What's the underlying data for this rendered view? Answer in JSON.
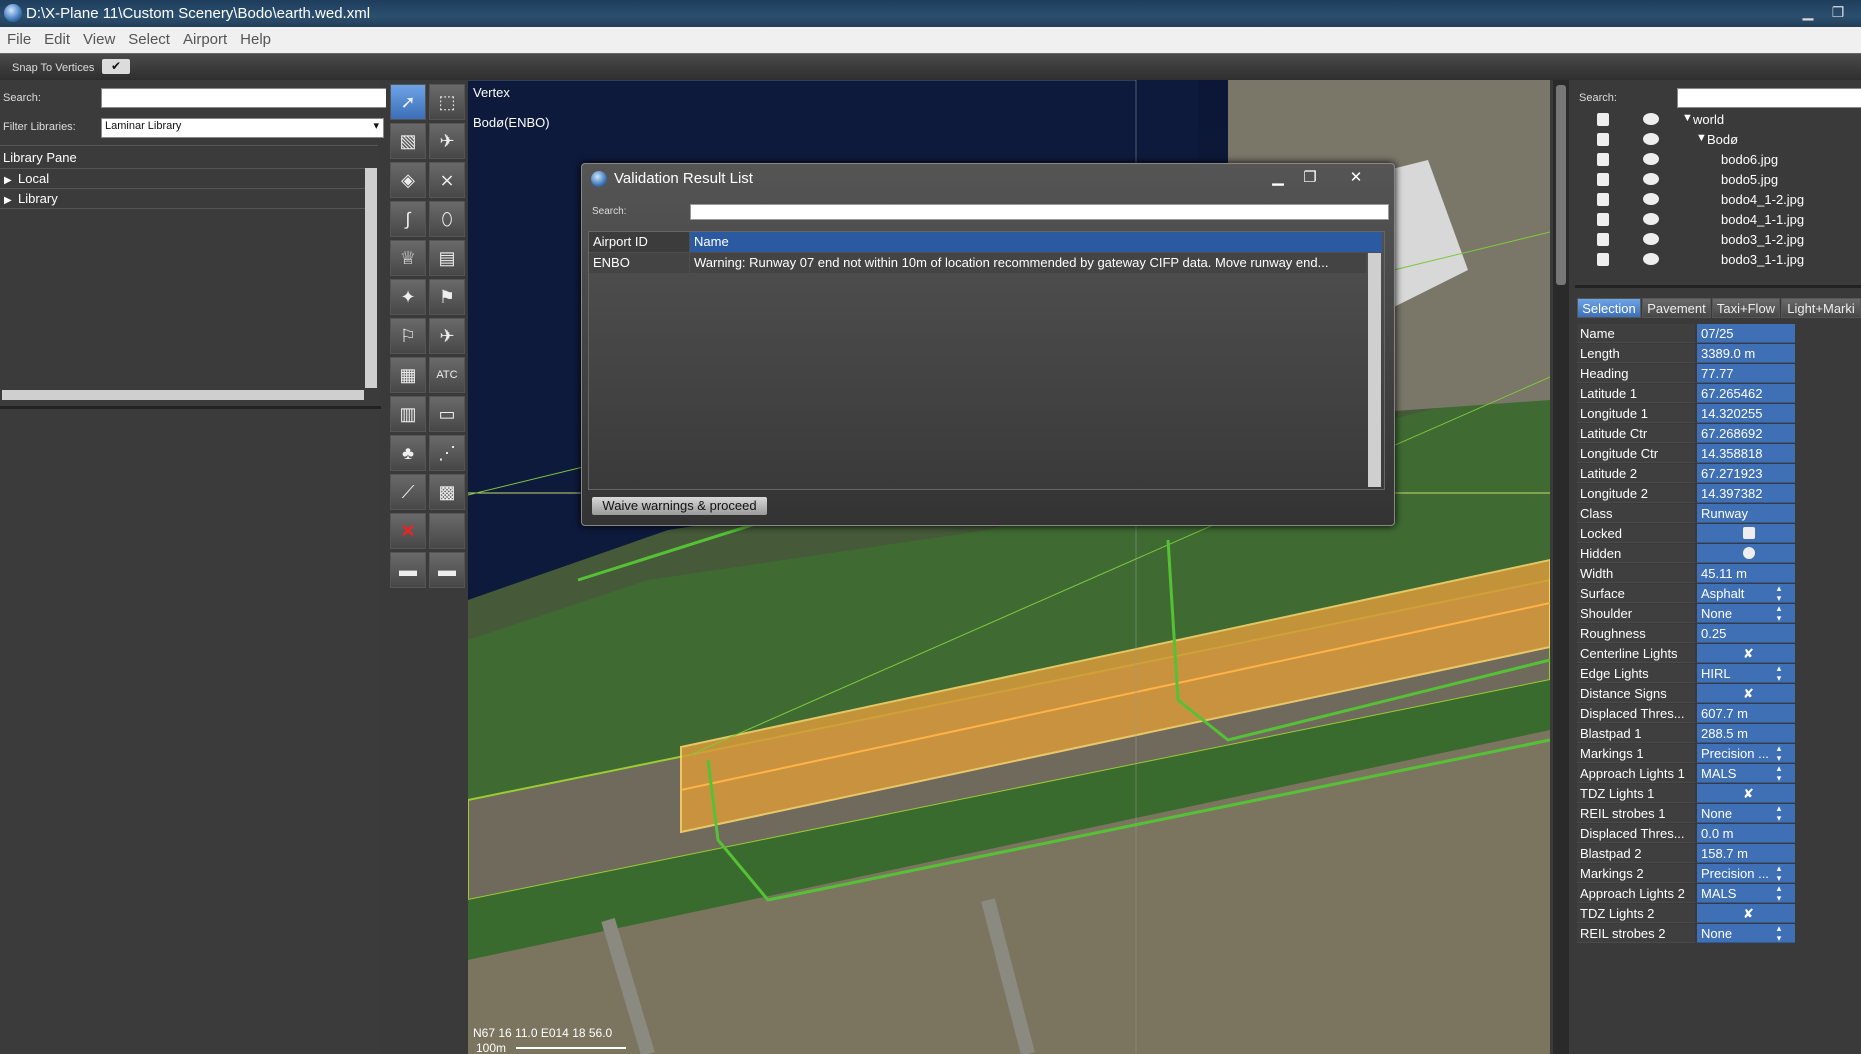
{
  "window": {
    "title": "D:\\X-Plane 11\\Custom Scenery\\Bodo\\earth.wed.xml"
  },
  "menu": [
    "File",
    "Edit",
    "View",
    "Select",
    "Airport",
    "Help"
  ],
  "snap": {
    "label": "Snap To Vertices",
    "checked_glyph": "✔"
  },
  "left": {
    "search_label": "Search:",
    "filter_label": "Filter Libraries:",
    "filter_value": "Laminar Library",
    "library_pane": "Library Pane",
    "tree": [
      {
        "label": "Local"
      },
      {
        "label": "Library"
      }
    ]
  },
  "tools": [
    {
      "icon": "vertex-select-icon",
      "glyph": "➚"
    },
    {
      "icon": "marquee-icon",
      "glyph": "⬚"
    },
    {
      "icon": "runway-icon",
      "glyph": "▧"
    },
    {
      "icon": "helipad-icon",
      "glyph": "✈"
    },
    {
      "icon": "taxiway-icon",
      "glyph": "◈"
    },
    {
      "icon": "ramp-icon",
      "glyph": "⨯"
    },
    {
      "icon": "taxi-route-icon",
      "glyph": "∫"
    },
    {
      "icon": "boundary-icon",
      "glyph": "⬯"
    },
    {
      "icon": "light-fixture-icon",
      "glyph": "♕"
    },
    {
      "icon": "sign-icon",
      "glyph": "▤"
    },
    {
      "icon": "object-icon",
      "glyph": "✦"
    },
    {
      "icon": "windsock-icon",
      "glyph": "⚑"
    },
    {
      "icon": "tower-icon",
      "glyph": "⚐"
    },
    {
      "icon": "startup-icon",
      "glyph": "✈"
    },
    {
      "icon": "facade-icon",
      "glyph": "▦"
    },
    {
      "icon": "atc-icon",
      "glyph": "ATC"
    },
    {
      "icon": "building-icon",
      "glyph": "▥"
    },
    {
      "icon": "polygon-icon",
      "glyph": "▭"
    },
    {
      "icon": "forest-icon",
      "glyph": "♣"
    },
    {
      "icon": "string-icon",
      "glyph": "⋰"
    },
    {
      "icon": "line-icon",
      "glyph": "⟋"
    },
    {
      "icon": "draped-icon",
      "glyph": "▩"
    },
    {
      "icon": "exclusion-icon",
      "glyph": "✕"
    },
    {
      "icon": "blank-icon",
      "glyph": ""
    },
    {
      "icon": "truck-icon",
      "glyph": "▬"
    },
    {
      "icon": "ambulance-icon",
      "glyph": "▬"
    }
  ],
  "map": {
    "tool_label": "Vertex",
    "airport_label": "Bodø(ENBO)",
    "coords": "N67 16 11.0 E014 18 56.0",
    "scale": "100m"
  },
  "dialog": {
    "title": "Validation Result List",
    "search_label": "Search:",
    "columns": [
      "Airport ID",
      "Name"
    ],
    "rows": [
      {
        "id": "ENBO",
        "name": "Warning: Runway 07 end not within 10m of location recommended by gateway CIFP data. Move runway end..."
      }
    ],
    "waive_button": "Waive warnings & proceed"
  },
  "right": {
    "search_label": "Search:",
    "layers": [
      {
        "label": "world",
        "arrow": "▼",
        "indent": 0
      },
      {
        "label": "Bodø",
        "arrow": "▼",
        "indent": 1
      },
      {
        "label": "bodo6.jpg",
        "arrow": "",
        "indent": 2
      },
      {
        "label": "bodo5.jpg",
        "arrow": "",
        "indent": 2
      },
      {
        "label": "bodo4_1-2.jpg",
        "arrow": "",
        "indent": 2
      },
      {
        "label": "bodo4_1-1.jpg",
        "arrow": "",
        "indent": 2
      },
      {
        "label": "bodo3_1-2.jpg",
        "arrow": "",
        "indent": 2
      },
      {
        "label": "bodo3_1-1.jpg",
        "arrow": "",
        "indent": 2
      }
    ],
    "tabs": [
      "Selection",
      "Pavement",
      "Taxi+Flow",
      "Light+Marki"
    ],
    "properties": [
      {
        "name": "Name",
        "value": "07/25",
        "kind": "text"
      },
      {
        "name": "Length",
        "value": "3389.0 m",
        "kind": "text"
      },
      {
        "name": "Heading",
        "value": "77.77",
        "kind": "text"
      },
      {
        "name": "Latitude 1",
        "value": "67.265462",
        "kind": "text"
      },
      {
        "name": "Longitude 1",
        "value": " 14.320255",
        "kind": "text"
      },
      {
        "name": "Latitude Ctr",
        "value": "67.268692",
        "kind": "text"
      },
      {
        "name": "Longitude Ctr",
        "value": " 14.358818",
        "kind": "text"
      },
      {
        "name": "Latitude 2",
        "value": "67.271923",
        "kind": "text"
      },
      {
        "name": "Longitude 2",
        "value": " 14.397382",
        "kind": "text"
      },
      {
        "name": "Class",
        "value": "Runway",
        "kind": "text"
      },
      {
        "name": "Locked",
        "value": "",
        "kind": "lock"
      },
      {
        "name": "Hidden",
        "value": "",
        "kind": "eye"
      },
      {
        "name": "Width",
        "value": "45.11 m",
        "kind": "text"
      },
      {
        "name": "Surface",
        "value": "Asphalt",
        "kind": "enum"
      },
      {
        "name": "Shoulder",
        "value": "None",
        "kind": "enum"
      },
      {
        "name": "Roughness",
        "value": "0.25",
        "kind": "text"
      },
      {
        "name": "Centerline Lights",
        "value": "✘",
        "kind": "check"
      },
      {
        "name": "Edge Lights",
        "value": "HIRL",
        "kind": "enum"
      },
      {
        "name": "Distance Signs",
        "value": "✘",
        "kind": "check"
      },
      {
        "name": "Displaced Thres...",
        "value": "607.7 m",
        "kind": "text"
      },
      {
        "name": "Blastpad 1",
        "value": "288.5 m",
        "kind": "text"
      },
      {
        "name": "Markings 1",
        "value": "Precision ...",
        "kind": "enum"
      },
      {
        "name": "Approach Lights 1",
        "value": "MALS",
        "kind": "enum"
      },
      {
        "name": "TDZ Lights 1",
        "value": "✘",
        "kind": "check"
      },
      {
        "name": "REIL strobes 1",
        "value": "None",
        "kind": "enum"
      },
      {
        "name": "Displaced Thres...",
        "value": "  0.0 m",
        "kind": "text"
      },
      {
        "name": "Blastpad 2",
        "value": "158.7 m",
        "kind": "text"
      },
      {
        "name": "Markings 2",
        "value": "Precision ...",
        "kind": "enum"
      },
      {
        "name": "Approach Lights 2",
        "value": "MALS",
        "kind": "enum"
      },
      {
        "name": "TDZ Lights 2",
        "value": "✘",
        "kind": "check"
      },
      {
        "name": "REIL strobes 2",
        "value": "None",
        "kind": "enum"
      }
    ]
  }
}
